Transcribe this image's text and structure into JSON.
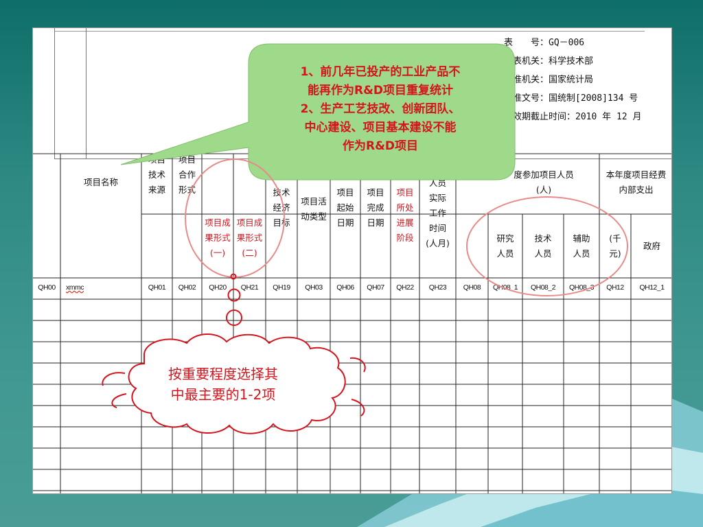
{
  "form_meta": {
    "line1": "表　　号：GQ－006",
    "line2": "制表机关：科学技术部",
    "line3": "批准机关：国家统计局",
    "line4": "批准文号：国统制[2008]134 号",
    "line5": "有效期截止时间：2010 年 12 月"
  },
  "headers": {
    "project_name": "项目名称",
    "tech_source": "项目\n技术\n来源",
    "coop_form": "项目\n合作\n形式",
    "result_form_1": "项目成\n果形式\n(一)",
    "result_form_2": "项目成\n果形式\n(二)",
    "econ_goal": "技术\n经济\n目标",
    "activity_type": "项目活\n动类型",
    "start_date": "项目\n起始\n日期",
    "end_date": "项目\n完成\n日期",
    "stage": "项目\n所处\n进展\n阶段",
    "personnel_time": "人员\n实际\n工作\n时间\n(人月)",
    "personnel_group": "度参加项目人员\n(人)",
    "researchers": "研究\n人员",
    "technicians": "技术\n人员",
    "assistants": "辅助\n人员",
    "expense_group": "本年度项目经费\n内部支出",
    "thousand_yuan": "(千\n元)",
    "government": "政府"
  },
  "codes": [
    "QH00",
    "xmmc",
    "QH01",
    "QH02",
    "QH20",
    "QH21",
    "QH19",
    "QH03",
    "QH06",
    "QH07",
    "QH22",
    "QH23",
    "QH08",
    "QH08_1",
    "QH08_2",
    "QH08_3",
    "QH12",
    "QH12_1"
  ],
  "callout": {
    "text": "1、前几年已投产的工业产品不\n能再作为R&D项目重复统计\n2、生产工艺技改、创新团队、\n中心建设、项目基本建设不能\n作为R&D项目",
    "fill": "#9fd98a"
  },
  "cloud": {
    "text": "按重要程度选择其\n中最主要的1-2项"
  },
  "colors": {
    "background": "#2f8a84",
    "annotation_red": "#d4141c",
    "ellipse_pink": "#e88a8a"
  }
}
